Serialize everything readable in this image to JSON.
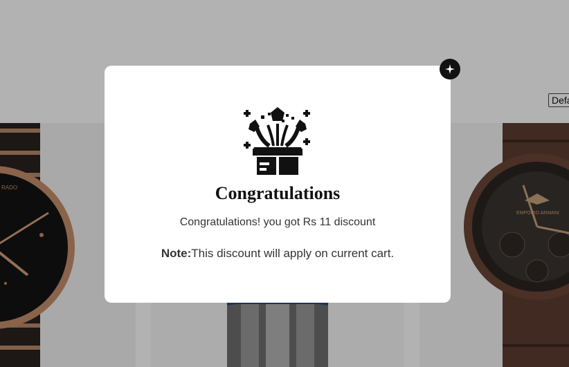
{
  "sort": {
    "selected_value": "Default"
  },
  "products": [
    {
      "name": "Rado watch",
      "dial_text": "RADO"
    },
    {
      "name": "Steel chronograph watch"
    },
    {
      "name": "Emporio Armani watch",
      "dial_text": "EMPORIO ARMANI"
    }
  ],
  "modal": {
    "icon": "gift-box-icon",
    "title": "Congratulations",
    "message": "Congratulations! you got Rs 11 discount",
    "note_label": "Note:",
    "note_text": "This discount will apply on current cart.",
    "close_icon": "close-icon"
  },
  "colors": {
    "overlay": "rgba(0,0,0,0.30)",
    "close_button": "#111111",
    "text": "#333333"
  }
}
